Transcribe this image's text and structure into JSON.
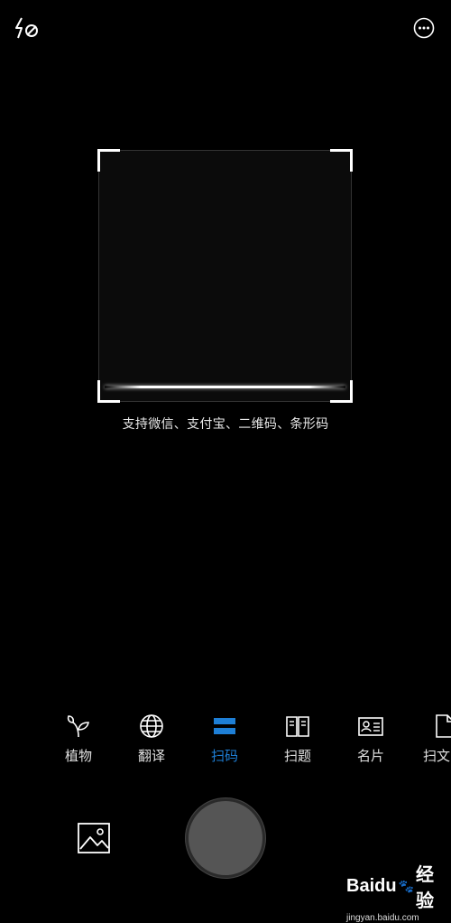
{
  "top_bar": {
    "flash_icon": "flash-off-icon",
    "more_icon": "more-icon"
  },
  "scan": {
    "hint": "支持微信、支付宝、二维码、条形码"
  },
  "modes": [
    {
      "label": "植物",
      "icon": "plant-icon",
      "active": false
    },
    {
      "label": "翻译",
      "icon": "globe-icon",
      "active": false
    },
    {
      "label": "扫码",
      "icon": "scan-code-icon",
      "active": true
    },
    {
      "label": "扫题",
      "icon": "book-icon",
      "active": false
    },
    {
      "label": "名片",
      "icon": "business-card-icon",
      "active": false
    },
    {
      "label": "扫文",
      "icon": "document-icon",
      "active": false
    }
  ],
  "colors": {
    "accent": "#1e7fd6",
    "background": "#000000"
  },
  "bottom": {
    "gallery_icon": "gallery-icon"
  },
  "watermark": {
    "brand": "Baidu",
    "brand_suffix": "经验",
    "url": "jingyan.baidu.com"
  }
}
